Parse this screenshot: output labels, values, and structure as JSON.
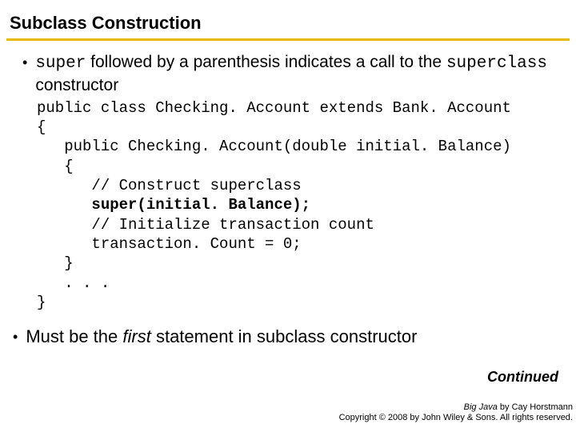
{
  "header": {
    "title": "Subclass Construction"
  },
  "bullet1": {
    "code1": "super",
    "text1": " followed by a parenthesis indicates a call to the ",
    "code2": "superclass",
    "text2": " constructor"
  },
  "code": {
    "l1": "public class Checking. Account extends Bank. Account",
    "l2": "{",
    "l3": "   public Checking. Account(double initial. Balance)",
    "l4": "   {",
    "l5": "      // Construct superclass",
    "l6": "      super(initial. Balance);",
    "l7": "      // Initialize transaction count",
    "l8": "      transaction. Count = 0;",
    "l9": "   }",
    "l10": "   . . .",
    "l11": "}"
  },
  "bullet2": {
    "text1": "Must be the ",
    "italic": "first",
    "text2": " statement in subclass constructor"
  },
  "continued": "Continued",
  "credits": {
    "book": "Big Java",
    "by": " by Cay Horstmann",
    "copyright": "Copyright © 2008 by John Wiley & Sons.  All rights reserved."
  }
}
